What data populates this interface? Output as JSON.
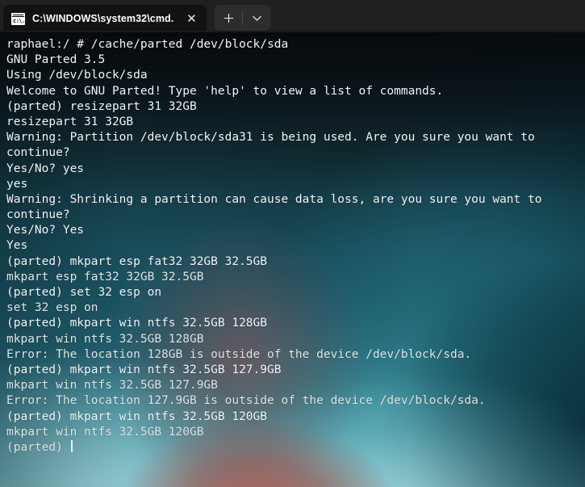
{
  "window": {
    "tab": {
      "icon": "cmd-console-icon",
      "title": "C:\\WINDOWS\\system32\\cmd.",
      "close_label": "✕"
    },
    "new_tab_label": "+",
    "dropdown_label": "⌄"
  },
  "terminal": {
    "colors": {
      "foreground": "#e6ebec",
      "cursor": "#eef4f5",
      "titlebar": "#202020",
      "tab_active": "#121212"
    },
    "cursor_visible": true,
    "lines": [
      {
        "text": "raphael:/ # /cache/parted /dev/block/sda",
        "style": "bright"
      },
      {
        "text": "GNU Parted 3.5",
        "style": "bright"
      },
      {
        "text": "Using /dev/block/sda",
        "style": "bright"
      },
      {
        "text": "Welcome to GNU Parted! Type 'help' to view a list of commands.",
        "style": "bright"
      },
      {
        "text": "(parted) resizepart 31 32GB",
        "style": "bright"
      },
      {
        "text": "resizepart 31 32GB",
        "style": "bright"
      },
      {
        "text": "Warning: Partition /dev/block/sda31 is being used. Are you sure you want to",
        "style": "bright"
      },
      {
        "text": "continue?",
        "style": "bright"
      },
      {
        "text": "Yes/No? yes",
        "style": "bright"
      },
      {
        "text": "yes",
        "style": "bright"
      },
      {
        "text": "Warning: Shrinking a partition can cause data loss, are you sure you want to",
        "style": "bright"
      },
      {
        "text": "continue?",
        "style": "bright"
      },
      {
        "text": "Yes/No? Yes",
        "style": "bright"
      },
      {
        "text": "Yes",
        "style": "bright"
      },
      {
        "text": "(parted) mkpart esp fat32 32GB 32.5GB",
        "style": "bright"
      },
      {
        "text": "mkpart esp fat32 32GB 32.5GB",
        "style": "dim"
      },
      {
        "text": "(parted) set 32 esp on",
        "style": "bright"
      },
      {
        "text": "set 32 esp on",
        "style": "dim"
      },
      {
        "text": "(parted) mkpart win ntfs 32.5GB 128GB",
        "style": "bright"
      },
      {
        "text": "mkpart win ntfs 32.5GB 128GB",
        "style": "dim"
      },
      {
        "text": "Error: The location 128GB is outside of the device /dev/block/sda.",
        "style": "dim"
      },
      {
        "text": "(parted) mkpart win ntfs 32.5GB 127.9GB",
        "style": "bright"
      },
      {
        "text": "mkpart win ntfs 32.5GB 127.9GB",
        "style": "dim"
      },
      {
        "text": "Error: The location 127.9GB is outside of the device /dev/block/sda.",
        "style": "dim"
      },
      {
        "text": "(parted) mkpart win ntfs 32.5GB 120GB",
        "style": "bright"
      },
      {
        "text": "mkpart win ntfs 32.5GB 120GB",
        "style": "dim"
      },
      {
        "text": "(parted) ",
        "style": "dim",
        "cursor": true
      }
    ]
  }
}
